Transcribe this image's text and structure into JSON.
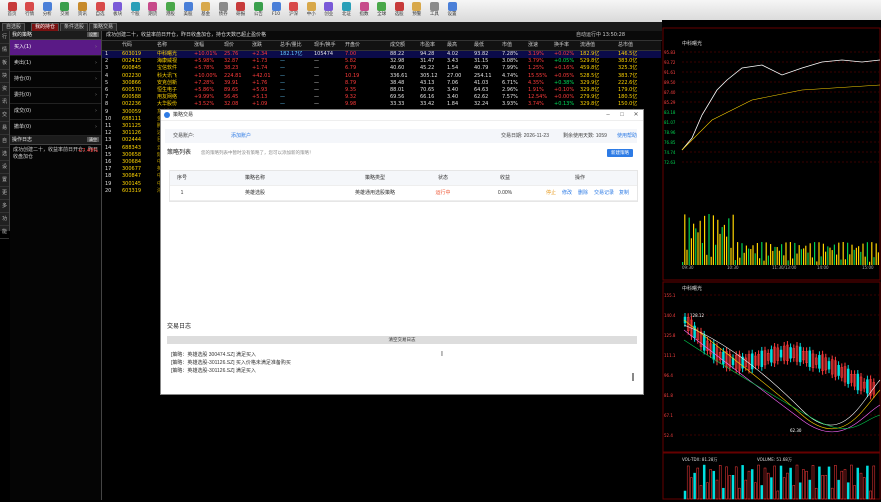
{
  "toolbar": {
    "buttons": [
      {
        "label": "首页",
        "color": "#c73b3b"
      },
      {
        "label": "行情",
        "color": "#d84a4a"
      },
      {
        "label": "分析",
        "color": "#4a7fd8"
      },
      {
        "label": "交易",
        "color": "#3a9f4c"
      },
      {
        "label": "资讯",
        "color": "#c78a2a"
      },
      {
        "label": "自选",
        "color": "#d84a4a"
      },
      {
        "label": "板块",
        "color": "#7a5ad8"
      },
      {
        "label": "个股",
        "color": "#2a9fb8"
      },
      {
        "label": "期货",
        "color": "#c74a8a"
      },
      {
        "label": "港股",
        "color": "#4aa84a"
      },
      {
        "label": "美股",
        "color": "#4a7fd8"
      },
      {
        "label": "基金",
        "color": "#d8a84a"
      },
      {
        "label": "债券",
        "color": "#8a8a8a"
      },
      {
        "label": "研报",
        "color": "#c73b3b"
      },
      {
        "label": "公告",
        "color": "#3a9f4c"
      },
      {
        "label": "F10",
        "color": "#4a7fd8"
      },
      {
        "label": "沪深",
        "color": "#d84a4a"
      },
      {
        "label": "中小",
        "color": "#d8a84a"
      },
      {
        "label": "创业",
        "color": "#7a5ad8"
      },
      {
        "label": "北证",
        "color": "#2a9fb8"
      },
      {
        "label": "指数",
        "color": "#c74a8a"
      },
      {
        "label": "全球",
        "color": "#4aa84a"
      },
      {
        "label": "选股",
        "color": "#c73b3b"
      },
      {
        "label": "预警",
        "color": "#d8a84a"
      },
      {
        "label": "工具",
        "color": "#8a8a8a"
      },
      {
        "label": "设置",
        "color": "#4a7fd8"
      }
    ]
  },
  "tabs": [
    {
      "label": "自选股",
      "active": false
    },
    {
      "label": "我的持仓",
      "active": true
    },
    {
      "label": "条件选股",
      "active": false
    },
    {
      "label": "策略交易",
      "active": false
    }
  ],
  "sidebar": [
    "行",
    "情",
    "板",
    "块",
    "资",
    "讯",
    "交",
    "易",
    "自",
    "选",
    "设",
    "置",
    "更",
    "多",
    "功",
    "能"
  ],
  "left_panel": {
    "header1": "我的策略",
    "header1_btn": "设置",
    "items": [
      "买入(1)",
      "卖出(1)",
      "持仓(0)",
      "委托(0)",
      "成交(0)",
      "撤单(0)"
    ],
    "header2": "操作日志",
    "header2_btn": "清空",
    "note": "成功创建二十，收益率前日开仓，昨日收盘加仓",
    "note_val": "+7.49%"
  },
  "center": {
    "info": "成功创建二十，收益率前日开仓，昨日收盘加仓，持仓天数已超止盈价格",
    "info_right": "自动运行中 13:50:28",
    "headers": [
      "",
      "代码",
      "名称",
      "涨幅",
      "现价",
      "涨跌",
      "总手/量比",
      "现手/换手",
      "开盘价",
      "成交额",
      "市盈率",
      "最高",
      "最低",
      "市值",
      "涨速",
      "换手率",
      "流通值",
      "总市值"
    ],
    "rows": [
      [
        "1",
        "603019",
        "中科曙光",
        "+10.01%",
        "25.76",
        "+2.34",
        "182.17亿",
        "105474",
        "7.00",
        "88.22",
        "94.28",
        "4.02",
        "93.82",
        "7.28%",
        "3.19%",
        "+0.02%",
        "182.9亿",
        "146.5亿"
      ],
      [
        "2",
        "002415",
        "海康威视",
        "+5.98%",
        "32.87",
        "+1.73",
        "—",
        "—",
        "5.82",
        "32.98",
        "31.47",
        "3.43",
        "31.15",
        "3.08%",
        "3.79%",
        "+0.05%",
        "529.8亿",
        "383.0亿"
      ],
      [
        "3",
        "600845",
        "宝信软件",
        "+5.78%",
        "38.23",
        "+1.74",
        "—",
        "—",
        "6.79",
        "40.60",
        "45.22",
        "1.54",
        "40.79",
        "7.99%",
        "1.25%",
        "+0.16%",
        "459.8亿",
        "325.3亿"
      ],
      [
        "4",
        "002230",
        "科大讯飞",
        "+10.00%",
        "224.81",
        "+42.01",
        "—",
        "—",
        "10.19",
        "336.61",
        "305.12",
        "27.00",
        "254.11",
        "4.74%",
        "15.55%",
        "+0.05%",
        "528.5亿",
        "383.7亿"
      ],
      [
        "5",
        "300866",
        "安克创新",
        "+7.28%",
        "39.91",
        "+1.76",
        "—",
        "—",
        "8.79",
        "38.48",
        "43.13",
        "7.06",
        "41.03",
        "6.71%",
        "4.35%",
        "+0.38%",
        "329.9亿",
        "222.6亿"
      ],
      [
        "6",
        "600570",
        "恒生电子",
        "+5.86%",
        "89.65",
        "+5.93",
        "—",
        "—",
        "9.35",
        "88.01",
        "70.65",
        "3.40",
        "64.63",
        "2.96%",
        "1.91%",
        "+0.10%",
        "329.8亿",
        "179.0亿"
      ],
      [
        "7",
        "600588",
        "用友网络",
        "+9.99%",
        "56.45",
        "+5.13",
        "—",
        "—",
        "9.32",
        "69.56",
        "66.16",
        "3.40",
        "62.62",
        "7.57%",
        "12.54%",
        "+0.00%",
        "279.9亿",
        "180.5亿"
      ],
      [
        "8",
        "002236",
        "大华股份",
        "+3.52%",
        "32.08",
        "+1.09",
        "—",
        "—",
        "9.98",
        "33.33",
        "33.42",
        "1.84",
        "32.24",
        "3.93%",
        "3.74%",
        "+0.13%",
        "329.8亿",
        "150.0亿"
      ],
      [
        "9",
        "300059",
        "东方财富",
        "+6.12%",
        "21.38",
        "+1.23",
        "—",
        "—",
        "7.16",
        "21.67",
        "20.98",
        "1.22",
        "20.58",
        "4.28%",
        "2.96%",
        "+0.08%",
        "329.8亿",
        "160.3亿"
      ],
      [
        "10",
        "688111",
        "金山办公",
        "+4.93%",
        "39.40",
        "+1.85",
        "—",
        "—",
        "6.84",
        "39.68",
        "38.12",
        "0.88",
        "37.95",
        "3.89%",
        "1.12%",
        "+0.11%",
        "179.8亿",
        "150.1亿"
      ],
      [
        "11",
        "301125",
        "腾亚精工",
        "",
        "",
        "",
        "",
        "",
        "",
        "",
        "",
        "",
        "",
        "",
        "",
        "",
        "",
        ""
      ],
      [
        "12",
        "301126",
        "达嘉维康",
        "",
        "",
        "",
        "",
        "",
        "",
        "",
        "",
        "",
        "",
        "",
        "",
        "",
        "",
        ""
      ],
      [
        "13",
        "002444",
        "巨星科技",
        "",
        "",
        "",
        "",
        "",
        "",
        "",
        "",
        "",
        "",
        "",
        "",
        "",
        "",
        ""
      ],
      [
        "14",
        "688343",
        "云天励飞",
        "",
        "",
        "",
        "",
        "",
        "",
        "",
        "",
        "",
        "",
        "",
        "",
        "",
        "",
        ""
      ],
      [
        "15",
        "300658",
        "延江股份",
        "",
        "",
        "",
        "",
        "",
        "",
        "",
        "",
        "",
        "",
        "",
        "",
        "",
        "",
        ""
      ],
      [
        "16",
        "300684",
        "中石科技",
        "",
        "",
        "",
        "",
        "",
        "",
        "",
        "",
        "",
        "",
        "",
        "",
        "",
        "",
        ""
      ],
      [
        "17",
        "300677",
        "英科医疗",
        "",
        "",
        "",
        "",
        "",
        "",
        "",
        "",
        "",
        "",
        "",
        "",
        "",
        "",
        ""
      ],
      [
        "18",
        "300847",
        "中船汉光",
        "",
        "",
        "",
        "",
        "",
        "",
        "",
        "",
        "",
        "",
        "",
        "",
        "",
        "",
        ""
      ],
      [
        "19",
        "300145",
        "中金环境",
        "",
        "",
        "",
        "",
        "",
        "",
        "",
        "",
        "",
        "",
        "",
        "",
        "",
        "",
        ""
      ],
      [
        "20",
        "603319",
        "湘油泵",
        "",
        "",
        "",
        "",
        "",
        "",
        "",
        "",
        "",
        "",
        "",
        "",
        "",
        "",
        ""
      ]
    ]
  },
  "right_charts": {
    "top_label": "中科曙光",
    "top_prices": [
      "95.83",
      "93.72",
      "91.61",
      "89.50",
      "87.40",
      "85.29",
      "83.18",
      "81.07",
      "78.96",
      "76.85",
      "74.74",
      "72.63"
    ],
    "time_labels": [
      "09:30",
      "10:30",
      "11:30/13:00",
      "14:00",
      "15:00"
    ],
    "kline_label": "中科曙光",
    "kline_prices": [
      "155.1",
      "140.4",
      "125.8",
      "111.1",
      "96.4",
      "81.8",
      "67.1",
      "52.4"
    ],
    "kline_mark_high": "128.12",
    "kline_mark_low": "62.30",
    "vol_label": "VOL-TDX: 81.28万",
    "vol_label2": "VOLUME: 51.68万"
  },
  "dialog": {
    "title": "策略交易",
    "account_label": "交易账户:",
    "account_value": "添加账户",
    "status_text": "交易日期: 2026-11-23",
    "status_text2": "剩余使用天数: 1059",
    "help_link": "使用帮助",
    "list_title": "策略列表",
    "list_hint": "您的策略列表中暂时没有策略了，您可以添加新的策略！",
    "new_btn": "新建策略",
    "columns": [
      "序号",
      "策略名称",
      "策略类型",
      "状态",
      "收益",
      "操作"
    ],
    "rows": [
      {
        "no": "1",
        "name": "英雄选股",
        "type": "英雄通用选股策略",
        "status": "运行中",
        "profit": "0.00%",
        "ops": [
          "停止",
          "修改",
          "删除",
          "交易记录",
          "复制"
        ]
      }
    ],
    "log_title": "交易日志",
    "log_bar": "清空交易日志",
    "log_lines": [
      "[策略：英雄选股 300474.SZ] 满足买入",
      "[策略：英雄选股-301126.SZ] 买入价格未满足准备购买",
      "[策略：英雄选股-301126.SZ] 满足买入"
    ]
  }
}
